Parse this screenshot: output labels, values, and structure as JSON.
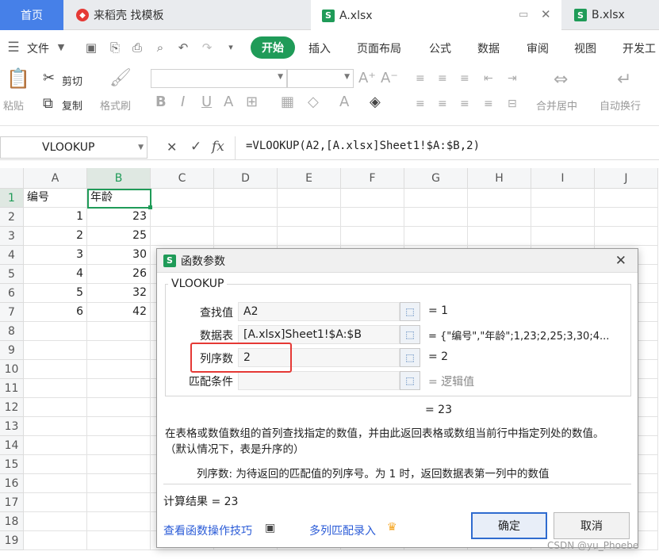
{
  "tabs": {
    "home": "首页",
    "daoke": "来稻壳 找模板",
    "a_file": "A.xlsx",
    "b_file": "B.xlsx"
  },
  "menu": {
    "file": "文件",
    "start": "开始",
    "insert": "插入",
    "page_layout": "页面布局",
    "formula": "公式",
    "data": "数据",
    "review": "审阅",
    "view": "视图",
    "dev": "开发工"
  },
  "ribbon": {
    "paste": "粘贴",
    "cut": "剪切",
    "copy": "复制",
    "format_painter": "格式刷",
    "merge_center": "合并居中",
    "auto_wrap": "自动换行"
  },
  "formula_bar": {
    "name_box": "VLOOKUP",
    "formula": "=VLOOKUP(A2,[A.xlsx]Sheet1!$A:$B,2)",
    "cancel": "✕",
    "confirm": "✓",
    "fx": "fx"
  },
  "sheet": {
    "columns": [
      "A",
      "B",
      "C",
      "D",
      "E",
      "F",
      "G",
      "H",
      "I",
      "J"
    ],
    "rows": [
      "1",
      "2",
      "3",
      "4",
      "5",
      "6",
      "7",
      "8",
      "9",
      "10",
      "11",
      "12",
      "13",
      "14",
      "15",
      "16",
      "17",
      "18",
      "19"
    ],
    "headers": [
      "编号",
      "年龄"
    ],
    "data": [
      [
        "1",
        "23"
      ],
      [
        "2",
        "25"
      ],
      [
        "3",
        "30"
      ],
      [
        "4",
        "26"
      ],
      [
        "5",
        "32"
      ],
      [
        "6",
        "42"
      ]
    ]
  },
  "dialog": {
    "title": "函数参数",
    "function_name": "VLOOKUP",
    "params": [
      {
        "label": "查找值",
        "value": "A2",
        "result": "= 1"
      },
      {
        "label": "数据表",
        "value": "[A.xlsx]Sheet1!$A:$B",
        "result": "= {\"编号\",\"年龄\";1,23;2,25;3,30;4..."
      },
      {
        "label": "列序数",
        "value": "2",
        "result": "= 2"
      },
      {
        "label": "匹配条件",
        "value": "",
        "result": "= 逻辑值"
      }
    ],
    "overall_result": "= 23",
    "description": "在表格或数值数组的首列查找指定的数值，并由此返回表格或数组当前行中指定列处的数值。（默认情况下，表是升序的）",
    "param_help": "列序数:  为待返回的匹配值的列序号。为 1 时，返回数据表第一列中的数值",
    "calc_result": "计算结果 = 23",
    "tips_link": "查看函数操作技巧",
    "multi_match_link": "多列匹配录入",
    "ok": "确定",
    "cancel": "取消"
  },
  "watermark": "CSDN @yu_Phoebe",
  "colors": {
    "accent_green": "#1f9b58",
    "home_tab": "#4680e8",
    "highlight_red": "#e53935",
    "link_blue": "#2a5bd7"
  }
}
